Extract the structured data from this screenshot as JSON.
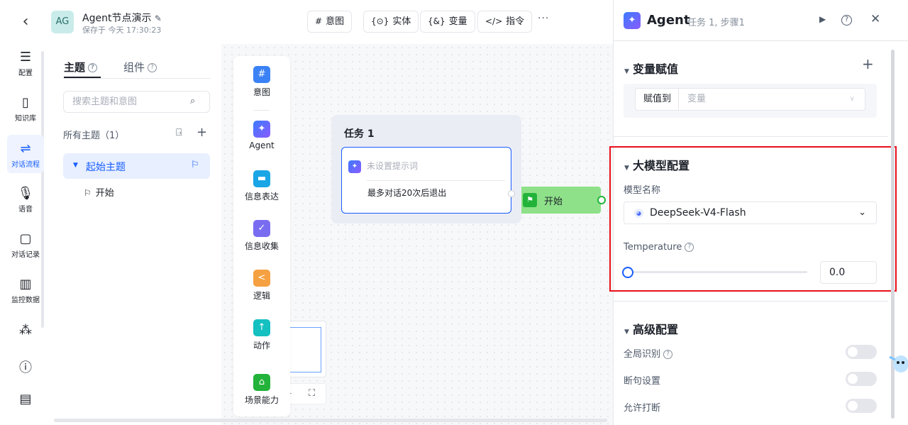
{
  "header": {
    "avatar": "AG",
    "title": "Agent节点演示",
    "save_status": "保存于 今天 17:30:23",
    "toolbar": [
      {
        "icon": "#",
        "label": "意图"
      },
      {
        "icon": "{⊙}",
        "label": "实体"
      },
      {
        "icon": "{&}",
        "label": "变量"
      },
      {
        "icon": "</>",
        "label": "指令"
      }
    ],
    "more": "···"
  },
  "rail": {
    "items": [
      {
        "label": "配置",
        "icon": "sliders-icon"
      },
      {
        "label": "知识库",
        "icon": "book-icon"
      },
      {
        "label": "对话流程",
        "icon": "flow-icon"
      },
      {
        "label": "语音",
        "icon": "mic-icon"
      },
      {
        "label": "对话记录",
        "icon": "chat-icon"
      },
      {
        "label": "监控数据",
        "icon": "chart-icon"
      }
    ]
  },
  "topic_panel": {
    "tabs": [
      "主题",
      "组件"
    ],
    "search_placeholder": "搜索主题和意图",
    "all_topics": "所有主题（1）",
    "topic": "起始主题",
    "sub_item": "开始"
  },
  "palette": {
    "items": [
      {
        "label": "意图",
        "color": "#3b82f6",
        "icon": "#"
      },
      {
        "label": "Agent",
        "color": "#5b6cff",
        "icon": "✦"
      },
      {
        "label": "信息表达",
        "color": "#1aa6e6",
        "icon": "▬"
      },
      {
        "label": "信息收集",
        "color": "#7a6cf0",
        "icon": "✓"
      },
      {
        "label": "逻辑",
        "color": "#f5a142",
        "icon": "<"
      },
      {
        "label": "动作",
        "color": "#14c0c0",
        "icon": "↑"
      },
      {
        "label": "场景能力",
        "color": "#23b33a",
        "icon": "⌂"
      }
    ]
  },
  "canvas": {
    "task_title": "任务 1",
    "prompt_placeholder": "未设置提示词",
    "exit_rule": "最多对话20次后退出",
    "start_node": "开始"
  },
  "right_panel": {
    "title": "Agent",
    "subtitle": "任务 1, 步骤1",
    "var_section": "变量赋值",
    "assign_label": "赋值到",
    "assign_placeholder": "变量",
    "llm_section": "大模型配置",
    "model_label": "模型名称",
    "model_value": "DeepSeek-V4-Flash",
    "temperature_label": "Temperature",
    "temperature_value": "0.0",
    "advanced_section": "高级配置",
    "toggles": [
      {
        "label": "全局识别",
        "on": false
      },
      {
        "label": "断句设置",
        "on": false
      },
      {
        "label": "允许打断",
        "on": false
      }
    ]
  }
}
